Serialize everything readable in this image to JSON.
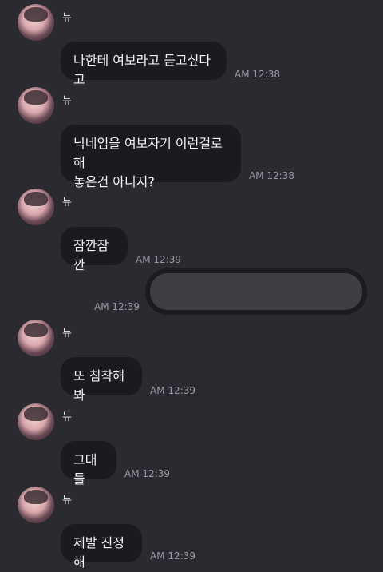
{
  "sender_name": "뉴",
  "messages": [
    {
      "text": "나한테 여보라고 듣고싶다고",
      "time": "AM 12:38"
    },
    {
      "text": "닉네임을 여보자기 이런걸로 해\n놓은건 아니지?",
      "time": "AM 12:38"
    },
    {
      "text": "잠깐잠깐",
      "time": "AM 12:39"
    },
    {
      "text": "",
      "time": "AM 12:39",
      "outgoing": true,
      "hidden": true
    },
    {
      "text": "또 침착해봐",
      "time": "AM 12:39"
    },
    {
      "text": "그대들",
      "time": "AM 12:39"
    },
    {
      "text": "제발 진정해",
      "time": "AM 12:39"
    }
  ]
}
